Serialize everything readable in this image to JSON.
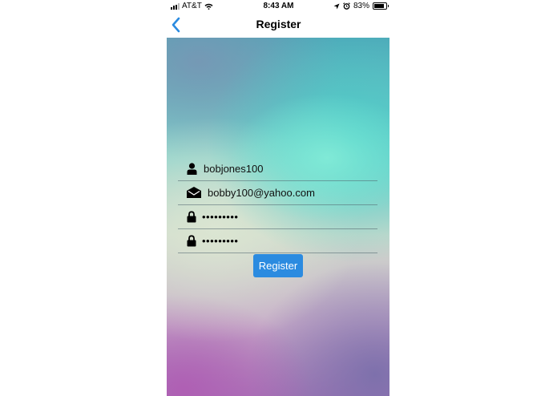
{
  "status_bar": {
    "carrier": "AT&T",
    "time": "8:43 AM",
    "battery": "83%",
    "battery_level": 0.83
  },
  "nav": {
    "title": "Register",
    "back_icon": "chevron-left-icon"
  },
  "form": {
    "username": {
      "value": "bobjones100",
      "icon": "user-icon"
    },
    "email": {
      "value": "bobby100@yahoo.com",
      "icon": "envelope-icon"
    },
    "password": {
      "value": "•••••••••",
      "icon": "lock-icon"
    },
    "confirm_password": {
      "value": "•••••••••",
      "icon": "lock-icon"
    },
    "submit_label": "Register"
  },
  "colors": {
    "accent": "#2b8be0",
    "back_chevron": "#2b8be0"
  }
}
